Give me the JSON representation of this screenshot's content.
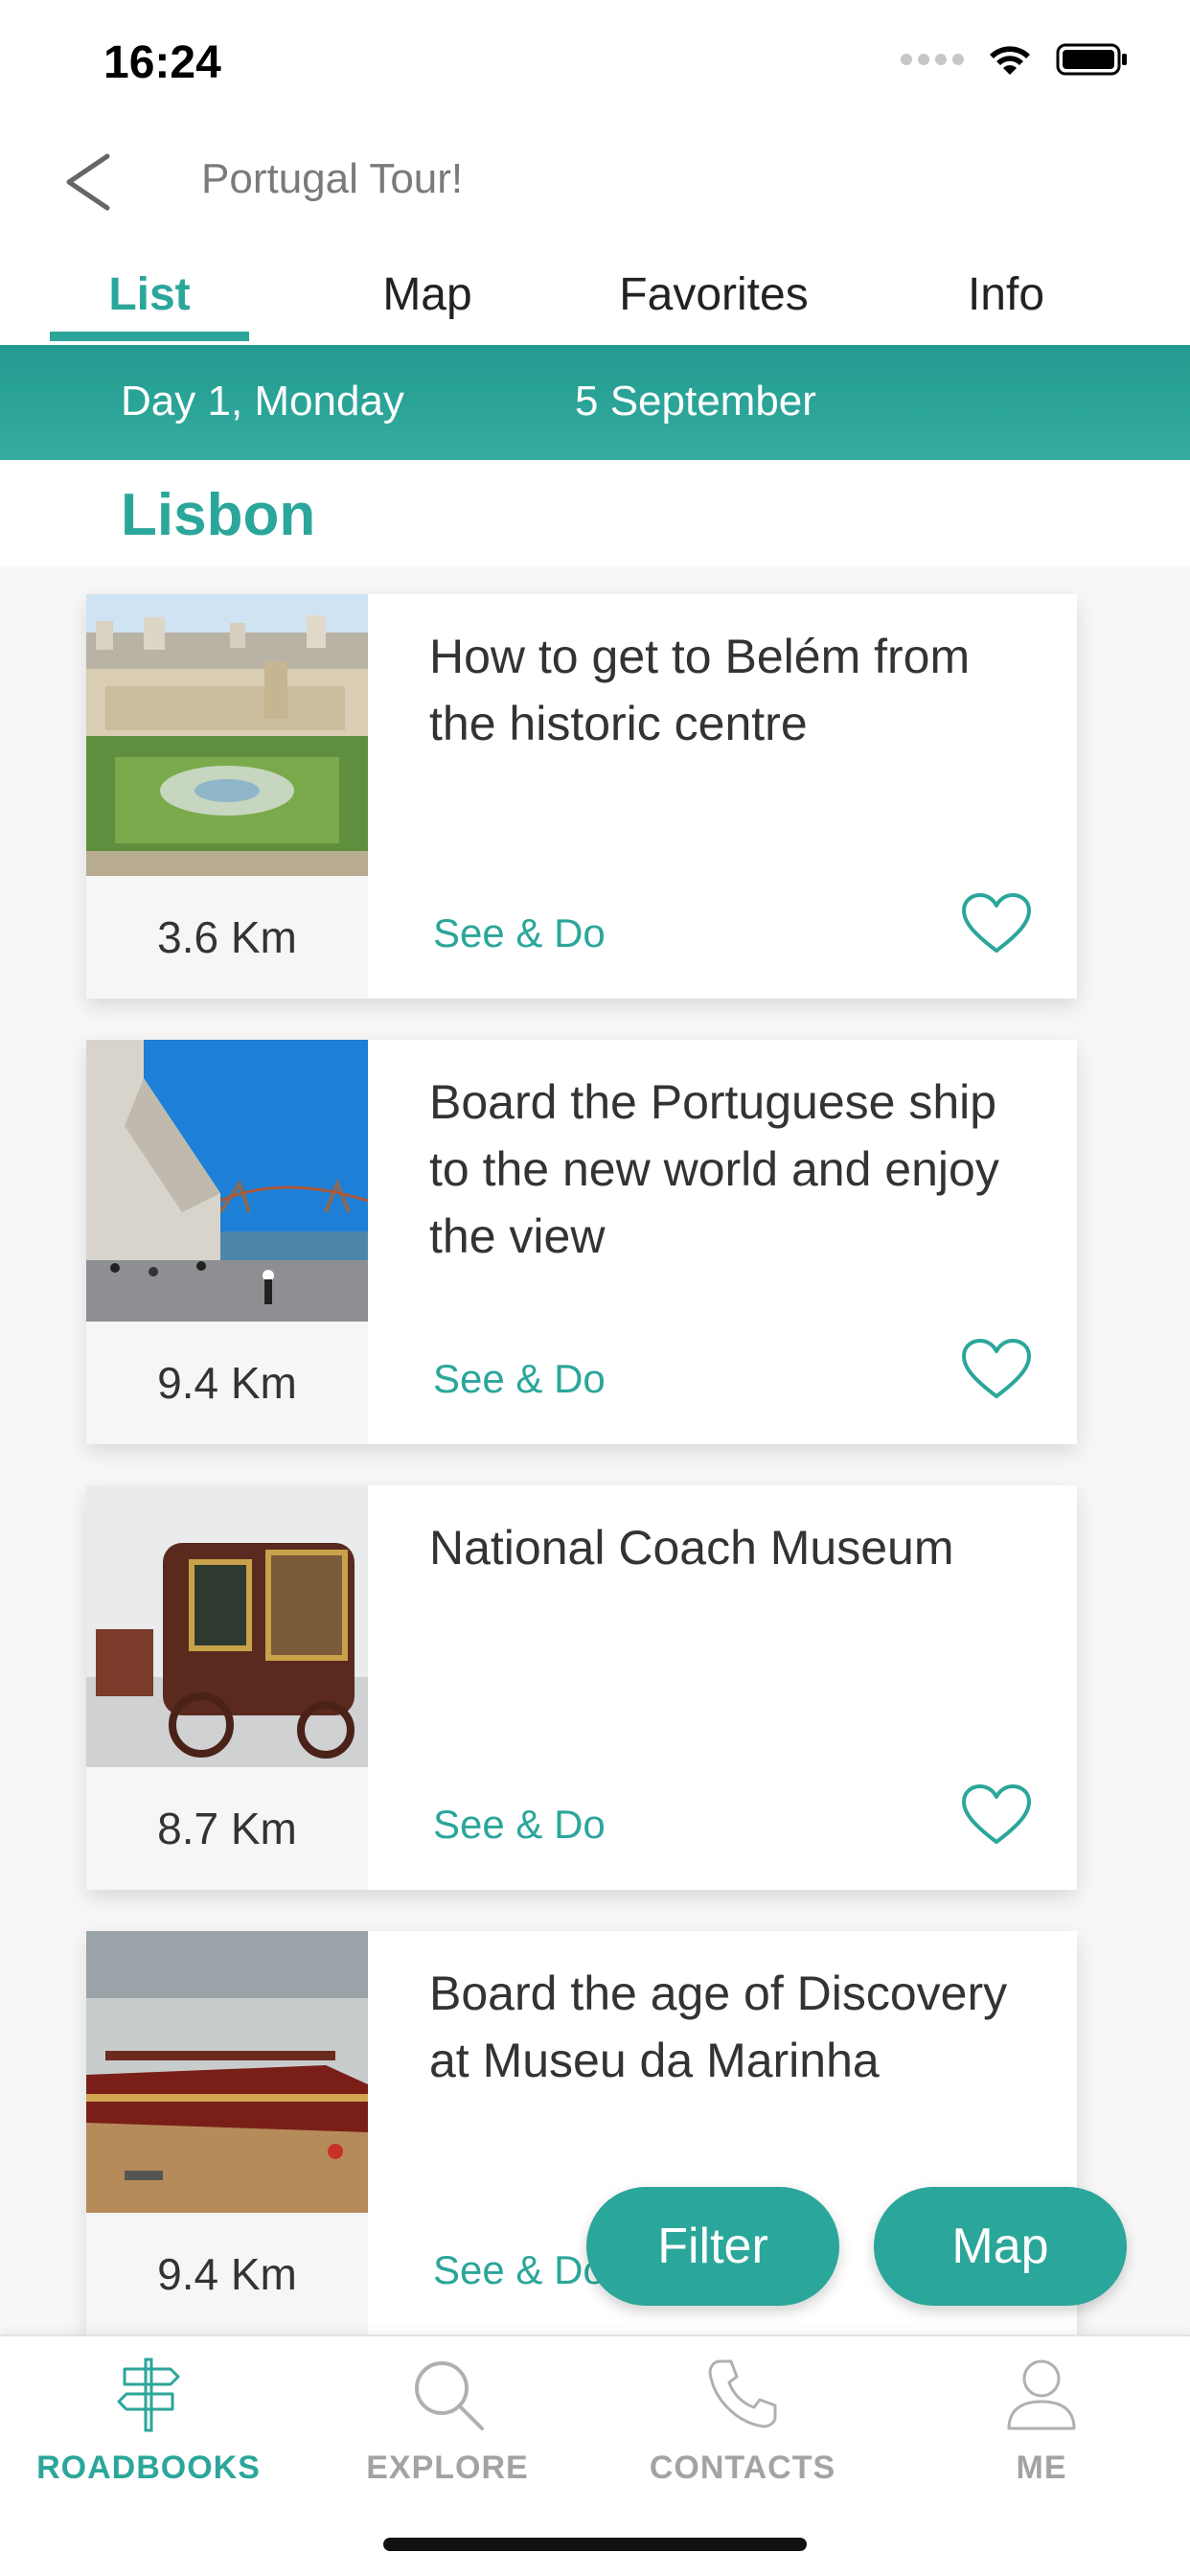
{
  "status_bar": {
    "time": "16:24"
  },
  "header": {
    "back_icon": "chevron-left-icon",
    "title": "Portugal Tour!"
  },
  "tabs": [
    {
      "label": "List",
      "active": true
    },
    {
      "label": "Map",
      "active": false
    },
    {
      "label": "Favorites",
      "active": false
    },
    {
      "label": "Info",
      "active": false
    }
  ],
  "day_banner": {
    "day": "Day 1, Monday",
    "date": "5 September"
  },
  "city": "Lisbon",
  "cards": [
    {
      "title": "How to get to Belém from the historic centre",
      "distance": "3.6 Km",
      "category": "See & Do",
      "favorite_icon": "heart-outline-icon"
    },
    {
      "title": "Board the Portuguese ship to the new world and enjoy the view",
      "distance": "9.4 Km",
      "category": "See & Do",
      "favorite_icon": "heart-outline-icon"
    },
    {
      "title": "National Coach Museum",
      "distance": "8.7 Km",
      "category": "See & Do",
      "favorite_icon": "heart-outline-icon"
    },
    {
      "title": "Board the age of Discovery at Museu da Marinha",
      "distance": "9.4 Km",
      "category": "See & Do",
      "favorite_icon": "heart-outline-icon"
    }
  ],
  "buttons": {
    "filter": "Filter",
    "map": "Map"
  },
  "bottom_nav": [
    {
      "label": "ROADBOOKS",
      "icon": "signpost-icon",
      "active": true
    },
    {
      "label": "EXPLORE",
      "icon": "search-icon",
      "active": false
    },
    {
      "label": "CONTACTS",
      "icon": "phone-icon",
      "active": false
    },
    {
      "label": "ME",
      "icon": "user-icon",
      "active": false
    }
  ],
  "colors": {
    "accent": "#2ba69a",
    "inactive": "#a3a3a3"
  }
}
